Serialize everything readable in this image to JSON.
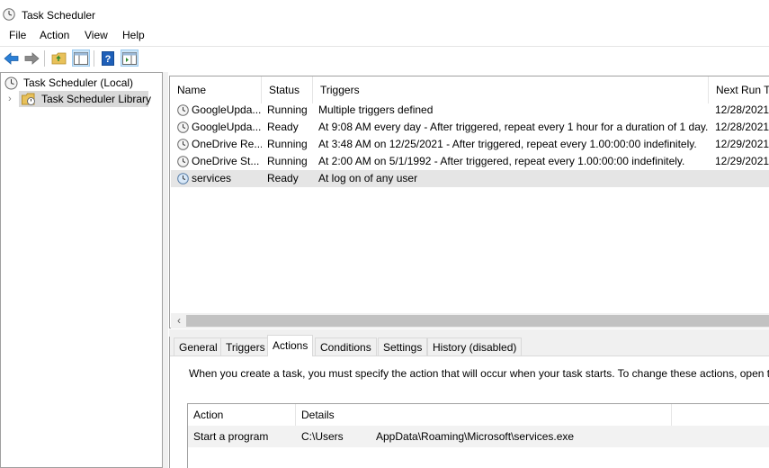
{
  "window": {
    "title": "Task Scheduler"
  },
  "menu": [
    "File",
    "Action",
    "View",
    "Help"
  ],
  "toolbar": {
    "buttons": [
      "back-arrow-icon",
      "forward-arrow-icon",
      "up-folder-icon",
      "show-hide-console-tree-icon",
      "help-icon",
      "show-hide-action-pane-icon"
    ]
  },
  "tree": {
    "root": "Task Scheduler (Local)",
    "library": "Task Scheduler Library"
  },
  "task_table": {
    "columns": [
      "Name",
      "Status",
      "Triggers",
      "Next Run Ti"
    ],
    "rows": [
      {
        "name": "GoogleUpda...",
        "status": "Running",
        "triggers": "Multiple triggers defined",
        "next_run": "12/28/2021"
      },
      {
        "name": "GoogleUpda...",
        "status": "Ready",
        "triggers": "At 9:08 AM every day - After triggered, repeat every 1 hour for a duration of 1 day.",
        "next_run": "12/28/2021"
      },
      {
        "name": "OneDrive Re...",
        "status": "Running",
        "triggers": "At 3:48 AM on 12/25/2021 - After triggered, repeat every 1.00:00:00 indefinitely.",
        "next_run": "12/29/2021"
      },
      {
        "name": "OneDrive St...",
        "status": "Running",
        "triggers": "At 2:00 AM on 5/1/1992 - After triggered, repeat every 1.00:00:00 indefinitely.",
        "next_run": "12/29/2021"
      },
      {
        "name": "services",
        "status": "Ready",
        "triggers": "At log on of any user",
        "next_run": ""
      }
    ],
    "selected_row": 4
  },
  "tabs": [
    "General",
    "Triggers",
    "Actions",
    "Conditions",
    "Settings",
    "History (disabled)"
  ],
  "active_tab": "Actions",
  "actions_pane": {
    "description": "When you create a task, you must specify the action that will occur when your task starts.  To change these actions, open th",
    "columns": [
      "Action",
      "Details"
    ],
    "rows": [
      {
        "action": "Start a program",
        "details_prefix": "C:\\Users",
        "details_suffix": "AppData\\Roaming\\Microsoft\\services.exe"
      }
    ]
  },
  "colors": {
    "selection": "#e5e5e5",
    "tree_selection": "#d9d9d9",
    "border": "#a0a0a0",
    "toolbar_blue": "#1e73d0"
  }
}
